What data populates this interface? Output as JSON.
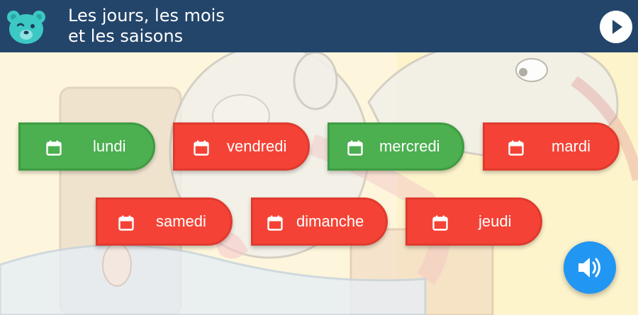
{
  "header": {
    "title_line1": "Les jours, les mois",
    "title_line2": "et les saisons",
    "logo_icon": "bear-face-icon",
    "play_icon": "play-icon"
  },
  "colors": {
    "header_bg": "#23456a",
    "correct": "#4caf50",
    "incorrect": "#f44336",
    "sound_button": "#2196f3"
  },
  "tags": [
    {
      "label": "lundi",
      "status": "correct",
      "icon": "calendar-icon"
    },
    {
      "label": "vendredi",
      "status": "incorrect",
      "icon": "calendar-icon"
    },
    {
      "label": "mercredi",
      "status": "correct",
      "icon": "calendar-icon"
    },
    {
      "label": "mardi",
      "status": "incorrect",
      "icon": "calendar-icon"
    },
    {
      "label": "samedi",
      "status": "incorrect",
      "icon": "calendar-icon"
    },
    {
      "label": "dimanche",
      "status": "incorrect",
      "icon": "calendar-icon"
    },
    {
      "label": "jeudi",
      "status": "incorrect",
      "icon": "calendar-icon"
    }
  ],
  "sound_icon": "speaker-icon"
}
